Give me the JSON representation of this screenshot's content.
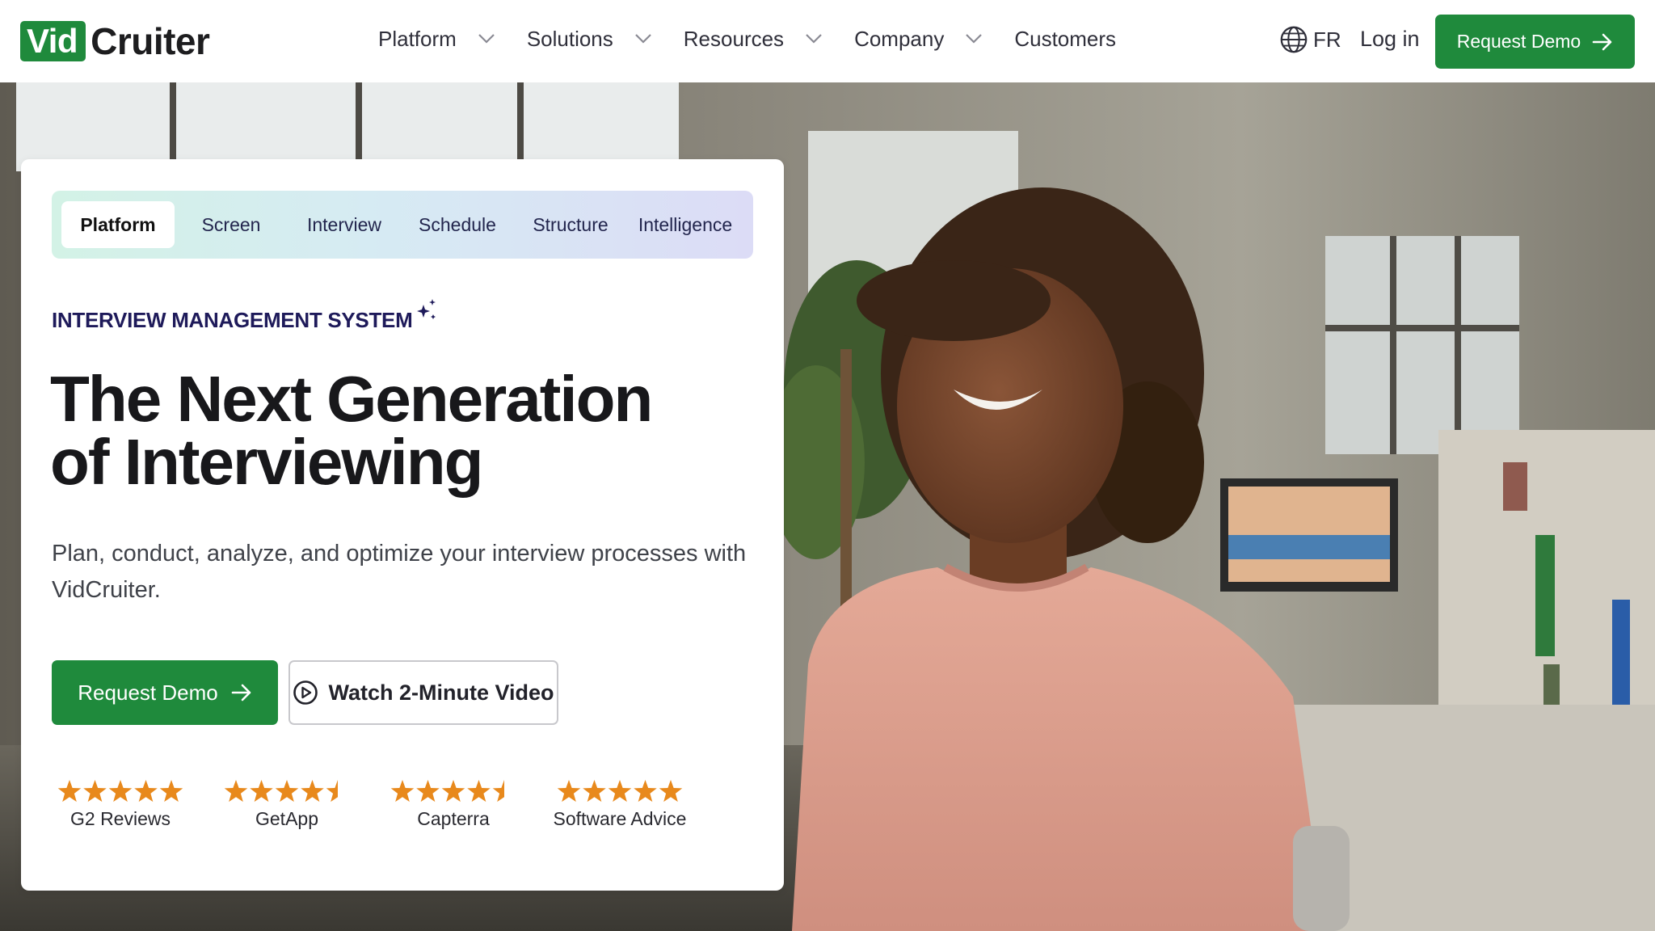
{
  "header": {
    "logo": {
      "part1": "Vid",
      "part2": "Cruiter"
    },
    "nav": [
      {
        "label": "Platform",
        "has_dropdown": true
      },
      {
        "label": "Solutions",
        "has_dropdown": true
      },
      {
        "label": "Resources",
        "has_dropdown": true
      },
      {
        "label": "Company",
        "has_dropdown": true
      },
      {
        "label": "Customers",
        "has_dropdown": false
      }
    ],
    "language": {
      "icon": "globe-icon",
      "label": "FR"
    },
    "login_label": "Log in",
    "cta_label": "Request Demo"
  },
  "hero": {
    "tabs": [
      {
        "label": "Platform",
        "active": true
      },
      {
        "label": "Screen",
        "active": false
      },
      {
        "label": "Interview",
        "active": false
      },
      {
        "label": "Schedule",
        "active": false
      },
      {
        "label": "Structure",
        "active": false
      },
      {
        "label": "Intelligence",
        "active": false
      }
    ],
    "eyebrow": "INTERVIEW MANAGEMENT SYSTEM",
    "headline_line1": "The Next Generation",
    "headline_line2": "of Interviewing",
    "subtext": "Plan, conduct, analyze, and optimize your interview processes with VidCruiter.",
    "primary_cta": "Request Demo",
    "secondary_cta": "Watch 2-Minute Video",
    "ratings": [
      {
        "label": "G2 Reviews",
        "stars": 5
      },
      {
        "label": "GetApp",
        "stars": 4.5
      },
      {
        "label": "Capterra",
        "stars": 4.5
      },
      {
        "label": "Software Advice",
        "stars": 5
      }
    ]
  },
  "colors": {
    "brand_green": "#1f8a3c",
    "navy_text": "#1e1a5a",
    "star_orange": "#e8891c"
  }
}
